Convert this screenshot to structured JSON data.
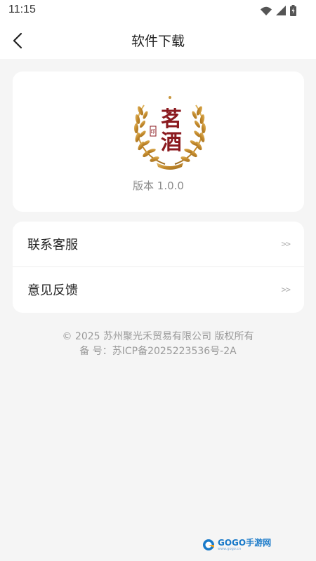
{
  "status_bar": {
    "time": "11:15",
    "icons": [
      "wifi-icon",
      "signal-icon",
      "battery-icon"
    ]
  },
  "nav": {
    "back_icon": "chevron-left-icon",
    "title": "软件下载"
  },
  "app_info": {
    "logo": {
      "char_top": "茗",
      "char_bottom": "酒",
      "seal": "印"
    },
    "version": "版本 1.0.0"
  },
  "menu": {
    "items": [
      {
        "label": "联系客服",
        "arrow": ">>"
      },
      {
        "label": "意见反馈",
        "arrow": ">>"
      }
    ]
  },
  "footer": {
    "copyright": "© 2025 苏州聚光禾贸易有限公司 版权所有",
    "icp": "备 号：苏ICP备2025223536号-2A"
  },
  "watermark": {
    "text": "GOGO手游网",
    "sub": "www.gogo.cn"
  },
  "colors": {
    "background": "#f5f5f5",
    "card": "#ffffff",
    "logo_red": "#8b1a1f",
    "logo_gold": "#c8963e"
  }
}
